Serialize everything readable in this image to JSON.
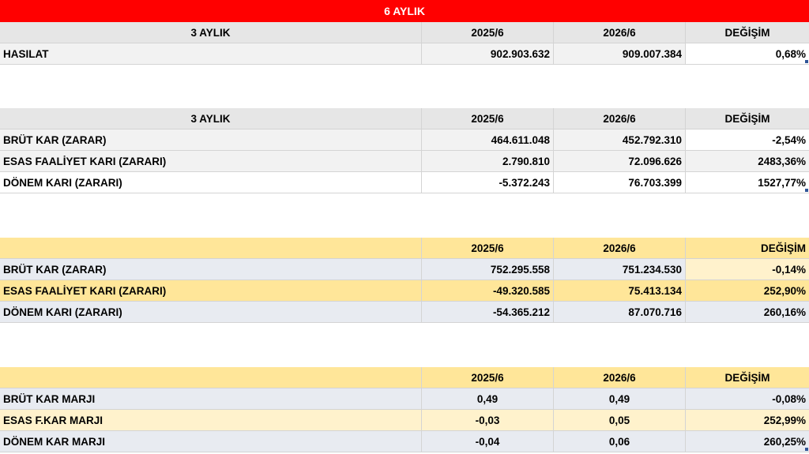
{
  "banner": "6 AYLIK",
  "section1": {
    "header": [
      "3 AYLIK",
      "2025/6",
      "2026/6",
      "DEĞİŞİM"
    ],
    "rows": [
      [
        "HASILAT",
        "902.903.632",
        "909.007.384",
        "0,68%"
      ]
    ]
  },
  "section2": {
    "header": [
      "3 AYLIK",
      "2025/6",
      "2026/6",
      "DEĞİŞİM"
    ],
    "rows": [
      [
        "BRÜT KAR (ZARAR)",
        "464.611.048",
        "452.792.310",
        "-2,54%"
      ],
      [
        "ESAS FAALİYET KARI (ZARARI)",
        "2.790.810",
        "72.096.626",
        "2483,36%"
      ],
      [
        "DÖNEM KARI (ZARARI)",
        "-5.372.243",
        "76.703.399",
        "1527,77%"
      ]
    ]
  },
  "section3": {
    "header": [
      "",
      "2025/6",
      "2026/6",
      "DEĞİŞİM"
    ],
    "rows": [
      [
        "BRÜT KAR (ZARAR)",
        "752.295.558",
        "751.234.530",
        "-0,14%"
      ],
      [
        "ESAS FAALİYET KARI (ZARARI)",
        "-49.320.585",
        "75.413.134",
        "252,90%"
      ],
      [
        "DÖNEM KARI (ZARARI)",
        "-54.365.212",
        "87.070.716",
        "260,16%"
      ]
    ]
  },
  "section4": {
    "header": [
      "",
      "2025/6",
      "2026/6",
      "DEĞİŞİM"
    ],
    "rows": [
      [
        "BRÜT KAR MARJI",
        "0,49",
        "0,49",
        "-0,08%"
      ],
      [
        "ESAS F.KAR MARJI",
        "-0,03",
        "0,05",
        "252,99%"
      ],
      [
        "DÖNEM KAR MARJI",
        "-0,04",
        "0,06",
        "260,25%"
      ]
    ]
  }
}
